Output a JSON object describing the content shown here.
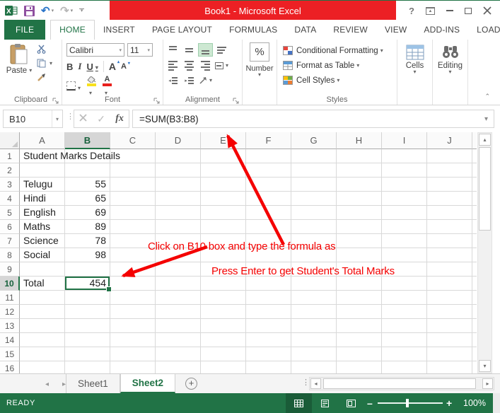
{
  "titlebar": {
    "title": "Book1 -  Microsoft Excel"
  },
  "ribbon": {
    "tabs": [
      "FILE",
      "HOME",
      "INSERT",
      "PAGE LAYOUT",
      "FORMULAS",
      "DATA",
      "REVIEW",
      "VIEW",
      "ADD-INS",
      "LOAD"
    ],
    "clipboard": {
      "paste_label": "Paste",
      "group_label": "Clipboard"
    },
    "font": {
      "family": "Calibri",
      "size": "11",
      "bold": "B",
      "italic": "I",
      "underline": "U",
      "grow": "A",
      "shrink": "A",
      "font_color": "A",
      "group_label": "Font"
    },
    "alignment": {
      "group_label": "Alignment"
    },
    "number": {
      "percent": "%",
      "group_label": "Number"
    },
    "styles": {
      "conditional": "Conditional Formatting",
      "format_table": "Format as Table",
      "cell_styles": "Cell Styles",
      "group_label": "Styles"
    },
    "cells": {
      "label": "Cells"
    },
    "editing": {
      "label": "Editing"
    }
  },
  "formula_bar": {
    "name_box": "B10",
    "fx_label": "fx",
    "formula": "=SUM(B3:B8)"
  },
  "grid": {
    "columns": [
      "A",
      "B",
      "C",
      "D",
      "E",
      "F",
      "G",
      "H",
      "I",
      "J"
    ],
    "row_count": 16,
    "selection": {
      "col": "B",
      "row": 10
    },
    "cells": [
      {
        "col": "A",
        "row": 1,
        "text": "Student Marks Details",
        "align": "left",
        "spill": true
      },
      {
        "col": "A",
        "row": 3,
        "text": "Telugu",
        "align": "left"
      },
      {
        "col": "B",
        "row": 3,
        "text": "55",
        "align": "right"
      },
      {
        "col": "A",
        "row": 4,
        "text": "Hindi",
        "align": "left"
      },
      {
        "col": "B",
        "row": 4,
        "text": "65",
        "align": "right"
      },
      {
        "col": "A",
        "row": 5,
        "text": "English",
        "align": "left"
      },
      {
        "col": "B",
        "row": 5,
        "text": "69",
        "align": "right"
      },
      {
        "col": "A",
        "row": 6,
        "text": "Maths",
        "align": "left"
      },
      {
        "col": "B",
        "row": 6,
        "text": "89",
        "align": "right"
      },
      {
        "col": "A",
        "row": 7,
        "text": "Science",
        "align": "left"
      },
      {
        "col": "B",
        "row": 7,
        "text": "78",
        "align": "right"
      },
      {
        "col": "A",
        "row": 8,
        "text": "Social",
        "align": "left"
      },
      {
        "col": "B",
        "row": 8,
        "text": "98",
        "align": "right"
      },
      {
        "col": "A",
        "row": 10,
        "text": "Total",
        "align": "left"
      },
      {
        "col": "B",
        "row": 10,
        "text": "454",
        "align": "right"
      }
    ]
  },
  "annotations": {
    "formula_note": "Click on B10 box and type the formula as",
    "enter_note": "Press Enter to get Student's Total Marks",
    "color": "#f40000"
  },
  "sheet_bar": {
    "tabs": [
      "Sheet1",
      "Sheet2"
    ],
    "active_tab": "Sheet2"
  },
  "status_bar": {
    "mode": "READY",
    "zoom_level": "100%"
  },
  "colors": {
    "excel_green": "#217346",
    "title_highlight": "#ec2024",
    "selection_border": "#217346",
    "annotation_red": "#f40000",
    "fill_yellow": "#f7e01d",
    "font_color_red": "#e8211d"
  }
}
